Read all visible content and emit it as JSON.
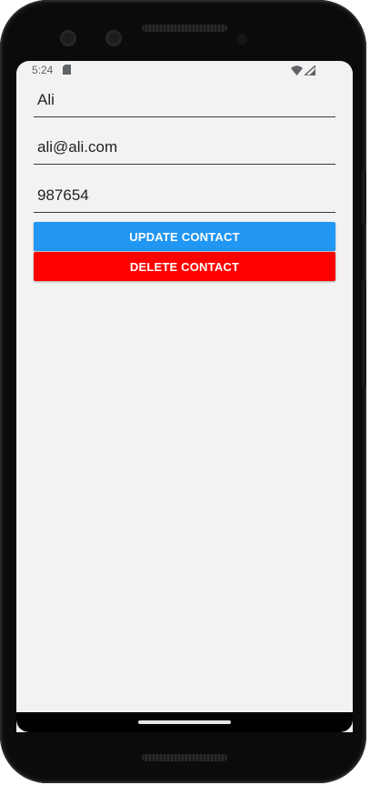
{
  "status_bar": {
    "time": "5:24",
    "icons": [
      "sd-card-icon",
      "wifi-icon",
      "cellular-signal-icon"
    ]
  },
  "form": {
    "name_value": "Ali",
    "email_value": "ali@ali.com",
    "phone_value": "987654"
  },
  "buttons": {
    "update_label": "UPDATE CONTACT",
    "delete_label": "DELETE CONTACT"
  },
  "colors": {
    "update_button": "#2196F3",
    "delete_button": "#FF0000",
    "screen_background": "#F2F2F2"
  },
  "nav_bar": {
    "icons": [
      "home-gesture-pill-icon"
    ]
  }
}
